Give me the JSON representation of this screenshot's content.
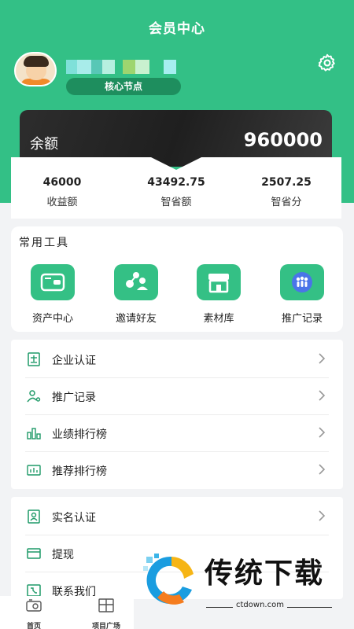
{
  "header": {
    "title": "会员中心",
    "username": "",
    "node_badge": "核心节点"
  },
  "balance": {
    "label": "余额",
    "value": "960000"
  },
  "stats": [
    {
      "value": "46000",
      "label": "收益额"
    },
    {
      "value": "43492.75",
      "label": "智省额"
    },
    {
      "value": "2507.25",
      "label": "智省分"
    }
  ],
  "tools": {
    "title": "常用工具",
    "items": [
      {
        "label": "资产中心",
        "icon": "wallet-icon"
      },
      {
        "label": "邀请好友",
        "icon": "invite-friends-icon"
      },
      {
        "label": "素材库",
        "icon": "store-icon"
      },
      {
        "label": "推广记录",
        "icon": "people-icon"
      }
    ]
  },
  "menu_group_1": [
    {
      "label": "企业认证",
      "icon": "certificate-icon"
    },
    {
      "label": "推广记录",
      "icon": "user-share-icon"
    },
    {
      "label": "业绩排行榜",
      "icon": "bar-rank-icon"
    },
    {
      "label": "推荐排行榜",
      "icon": "chart-rank-icon"
    }
  ],
  "menu_group_2": [
    {
      "label": "实名认证",
      "icon": "id-card-icon"
    },
    {
      "label": "提现",
      "icon": "card-icon"
    },
    {
      "label": "联系我们",
      "icon": "phone-icon"
    }
  ],
  "bottom_nav": [
    {
      "label": "首页",
      "icon": "home-icon"
    },
    {
      "label": "项目广场",
      "icon": "grid-icon"
    }
  ],
  "watermark": {
    "brand": "传统下载",
    "url": "ctdown.com"
  },
  "colors": {
    "primary": "#33c086",
    "badge": "#1e8e5e",
    "card_dark": "#2a2a2a"
  }
}
